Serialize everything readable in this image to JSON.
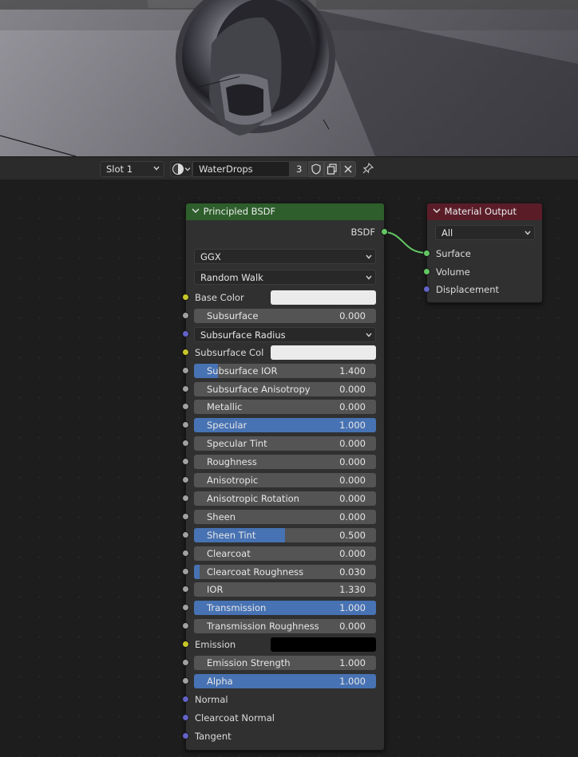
{
  "node_editor": {
    "slot": "Slot 1",
    "material_name": "WaterDrops",
    "material_users": "3"
  },
  "principled_bsdf": {
    "title": "Principled BSDF",
    "output_label": "BSDF",
    "distribution": "GGX",
    "subsurface_method": "Random Walk",
    "inputs": [
      {
        "label": "Base Color",
        "kind": "color",
        "socket": "yellow",
        "color": "#ebebeb"
      },
      {
        "label": "Subsurface",
        "kind": "slider",
        "socket": "grey",
        "value": "0.000",
        "fraction": 0
      },
      {
        "label": "Subsurface Radius",
        "kind": "dropdown",
        "socket": "blue"
      },
      {
        "label": "Subsurface Col",
        "kind": "color",
        "socket": "yellow",
        "color": "#ebebeb"
      },
      {
        "label": "Subsurface IOR",
        "kind": "slider",
        "socket": "grey",
        "value": "1.400",
        "fraction": 0.13
      },
      {
        "label": "Subsurface Anisotropy",
        "kind": "slider",
        "socket": "grey",
        "value": "0.000",
        "fraction": 0
      },
      {
        "label": "Metallic",
        "kind": "slider",
        "socket": "grey",
        "value": "0.000",
        "fraction": 0
      },
      {
        "label": "Specular",
        "kind": "slider",
        "socket": "grey",
        "value": "1.000",
        "fraction": 1
      },
      {
        "label": "Specular Tint",
        "kind": "slider",
        "socket": "grey",
        "value": "0.000",
        "fraction": 0
      },
      {
        "label": "Roughness",
        "kind": "slider",
        "socket": "grey",
        "value": "0.000",
        "fraction": 0
      },
      {
        "label": "Anisotropic",
        "kind": "slider",
        "socket": "grey",
        "value": "0.000",
        "fraction": 0
      },
      {
        "label": "Anisotropic Rotation",
        "kind": "slider",
        "socket": "grey",
        "value": "0.000",
        "fraction": 0
      },
      {
        "label": "Sheen",
        "kind": "slider",
        "socket": "grey",
        "value": "0.000",
        "fraction": 0
      },
      {
        "label": "Sheen Tint",
        "kind": "slider",
        "socket": "grey",
        "value": "0.500",
        "fraction": 0.5
      },
      {
        "label": "Clearcoat",
        "kind": "slider",
        "socket": "grey",
        "value": "0.000",
        "fraction": 0
      },
      {
        "label": "Clearcoat Roughness",
        "kind": "slider",
        "socket": "grey",
        "value": "0.030",
        "fraction": 0.03
      },
      {
        "label": "IOR",
        "kind": "slider",
        "socket": "grey",
        "value": "1.330",
        "fraction": 0
      },
      {
        "label": "Transmission",
        "kind": "slider",
        "socket": "grey",
        "value": "1.000",
        "fraction": 1
      },
      {
        "label": "Transmission Roughness",
        "kind": "slider",
        "socket": "grey",
        "value": "0.000",
        "fraction": 0
      },
      {
        "label": "Emission",
        "kind": "color",
        "socket": "yellow",
        "color": "#000000"
      },
      {
        "label": "Emission Strength",
        "kind": "slider",
        "socket": "grey",
        "value": "1.000",
        "fraction": 0
      },
      {
        "label": "Alpha",
        "kind": "slider",
        "socket": "grey",
        "value": "1.000",
        "fraction": 1
      },
      {
        "label": "Normal",
        "kind": "vector",
        "socket": "blue"
      },
      {
        "label": "Clearcoat Normal",
        "kind": "vector",
        "socket": "blue"
      },
      {
        "label": "Tangent",
        "kind": "vector",
        "socket": "blue"
      }
    ]
  },
  "material_output": {
    "title": "Material Output",
    "target": "All",
    "inputs": [
      {
        "label": "Surface",
        "socket": "green"
      },
      {
        "label": "Volume",
        "socket": "green"
      },
      {
        "label": "Displacement",
        "socket": "blue"
      }
    ]
  },
  "colors": {
    "bsdf_header": "#2d5e2b",
    "output_header": "#5a1d28",
    "slider_fill": "#4772b3",
    "wire": "#63c763"
  }
}
